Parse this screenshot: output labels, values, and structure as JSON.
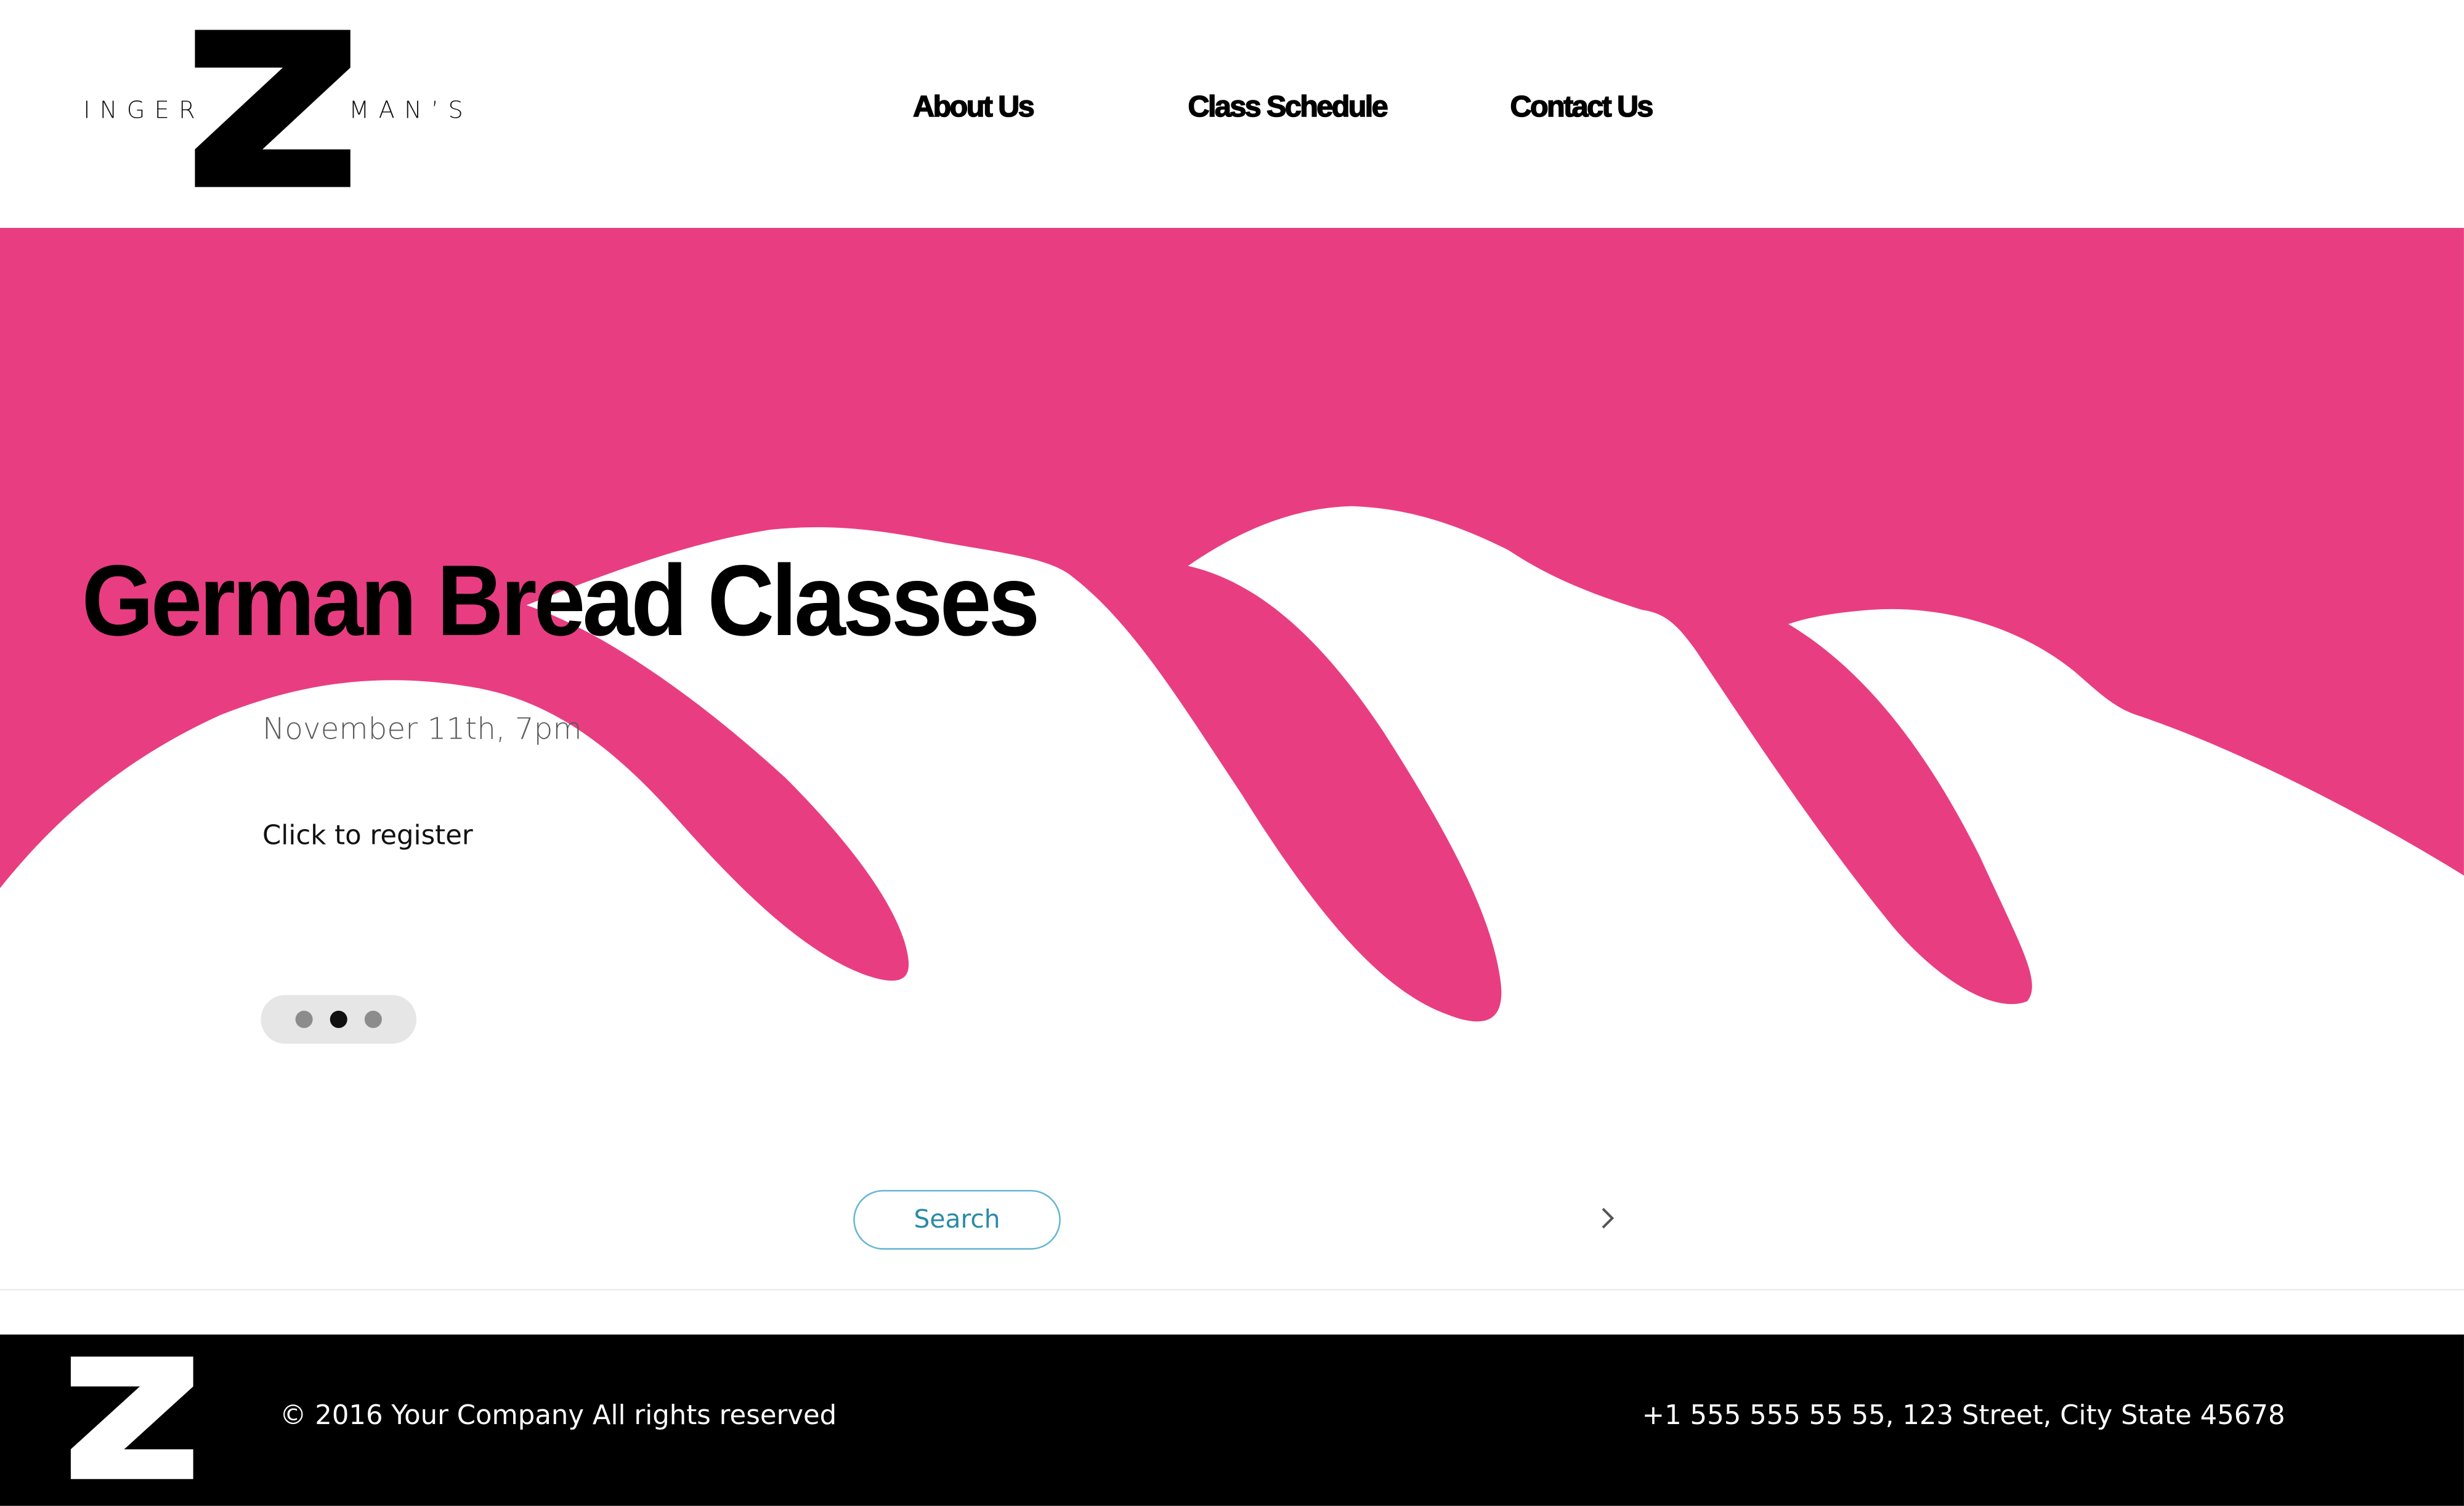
{
  "brand": {
    "logo_letter": "Z",
    "logo_left_text": "INGER",
    "logo_right_text": "MAN’S"
  },
  "nav": {
    "items": [
      {
        "label": "About Us"
      },
      {
        "label": "Class Schedule"
      },
      {
        "label": "Contact Us"
      }
    ]
  },
  "hero": {
    "title": "German Bread Classes",
    "date": "November 11th, 7pm",
    "cta": "Click to register",
    "slides_total": 3,
    "active_slide": 2
  },
  "search": {
    "button_label": "Search"
  },
  "footer": {
    "copyright": "© 2016 Your Company All rights reserved",
    "contact": "+1 555 555 55 55, 123 Street, City State 45678"
  },
  "colors": {
    "accent_pink": "#e93d82",
    "header_bg": "#ffffff",
    "footer_bg": "#000000",
    "search_border": "#66b7cf",
    "search_text": "#2b8aa8",
    "dot_active": "#111111",
    "dot_inactive": "#8c8c8c"
  }
}
